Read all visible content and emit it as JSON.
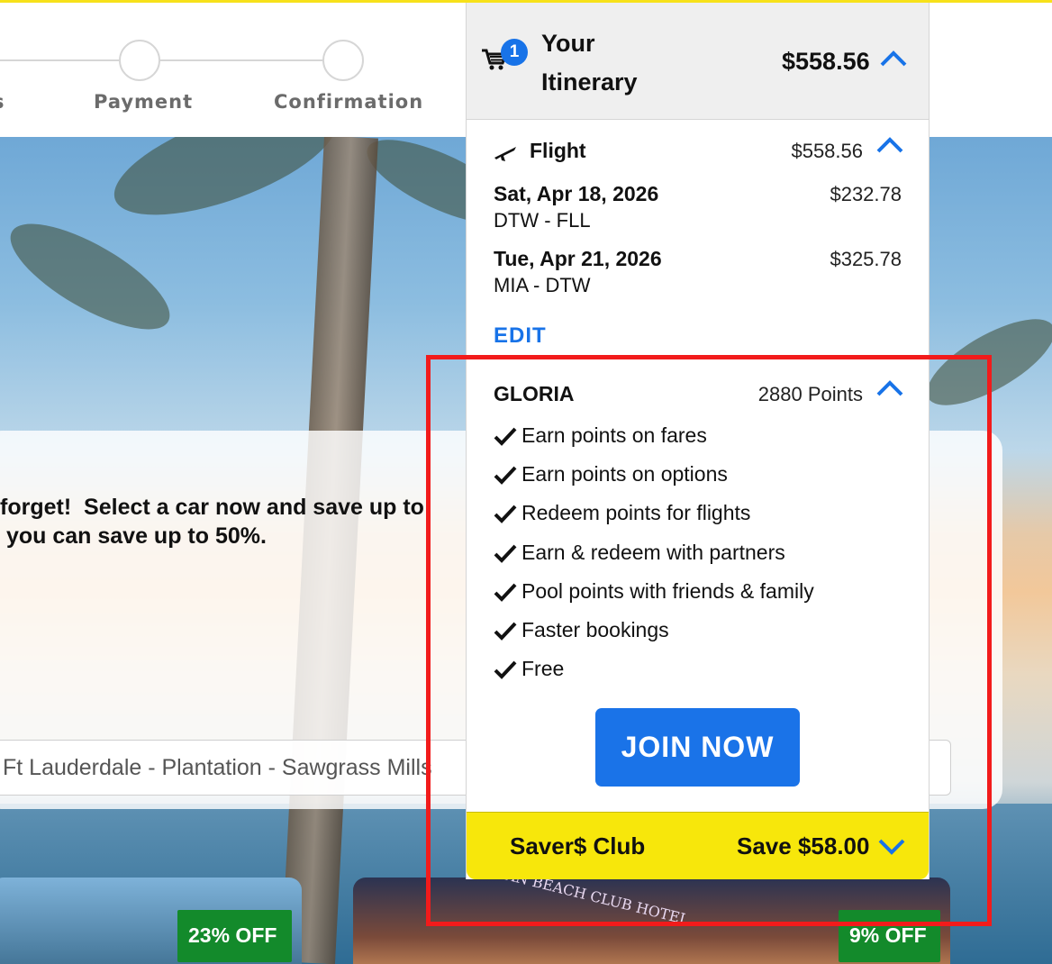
{
  "progress": {
    "steps": [
      "s",
      "Payment",
      "Confirmation"
    ]
  },
  "itinerary": {
    "cart_count": "1",
    "title_line1": "Your",
    "title_line2": "Itinerary",
    "total": "$558.56",
    "flight": {
      "label": "Flight",
      "price": "$558.56",
      "legs": [
        {
          "date": "Sat, Apr 18, 2026",
          "route": "DTW - FLL",
          "price": "$232.78"
        },
        {
          "date": "Tue, Apr 21, 2026",
          "route": "MIA - DTW",
          "price": "$325.78"
        }
      ],
      "edit_label": "EDIT"
    },
    "loyalty": {
      "name": "GLORIA",
      "points": "2880 Points",
      "benefits": [
        "Earn points on fares",
        "Earn points on options",
        "Redeem points for flights",
        "Earn & redeem with partners",
        "Pool points with friends & family",
        "Faster bookings",
        "Free"
      ],
      "join_label": "JOIN NOW"
    },
    "savers_club": {
      "label": "Saver$ Club",
      "save": "Save $58.00"
    }
  },
  "promo": {
    "line1": "forget!  Select a car now and save up to",
    "line2": " you can save up to 50%.",
    "location_value": "Ft Lauderdale - Plantation - Sawgrass Mills"
  },
  "hotels": [
    {
      "discount": "23% OFF"
    },
    {
      "discount": "9% OFF",
      "sign": "OCEAN BEACH CLUB HOTEL"
    }
  ],
  "colors": {
    "accent_blue": "#1873e8",
    "saver_yellow": "#f7e70b",
    "highlight_red": "#f21b1b",
    "discount_green": "#138a2b"
  }
}
